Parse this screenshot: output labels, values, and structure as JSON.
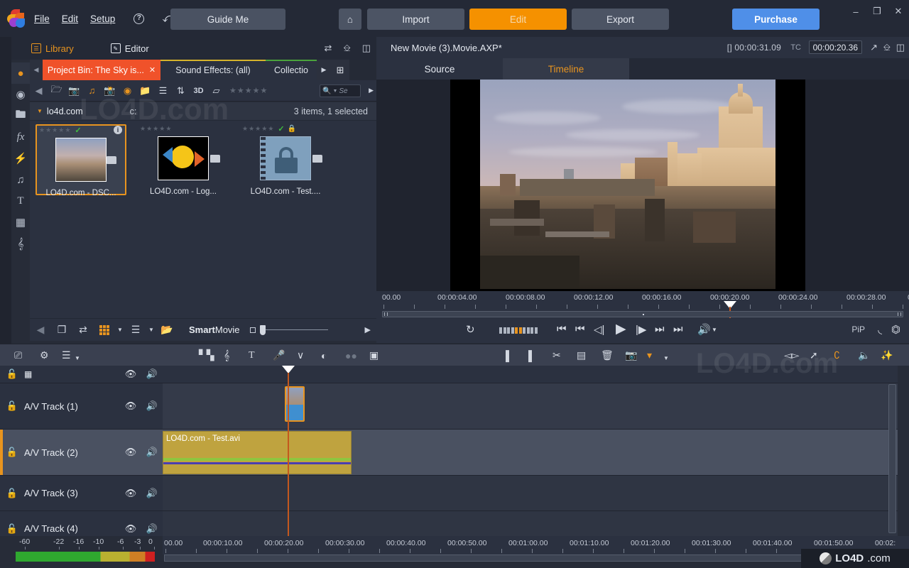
{
  "titlebar": {
    "menus": [
      "File",
      "Edit",
      "Setup"
    ],
    "help_icon": "help-icon",
    "undo_icon": "undo-arrow-icon",
    "redo_icon": "redo-arrow-icon",
    "guide_me": "Guide Me",
    "home_icon": "home-icon",
    "import": "Import",
    "edit": "Edit",
    "export": "Export",
    "purchase": "Purchase",
    "minimize": "–",
    "maximize": "❐",
    "close": "✕",
    "accent_orange": "#f59100",
    "accent_blue": "#4f8fe8"
  },
  "library": {
    "tab_library": "Library",
    "tab_editor": "Editor",
    "bin_tabs": [
      {
        "label": "Project Bin: The Sky is...",
        "close": "✕",
        "accent": "#f0522a",
        "active": true
      },
      {
        "label": "Sound Effects: (all)",
        "accent": "#d6b32b",
        "active": false
      },
      {
        "label": "Collectio",
        "accent": "#4aa33c",
        "active": false
      }
    ],
    "search_placeholder": "Se",
    "path_name": "lo4d.com",
    "path_drive": "c:",
    "item_count": "3 items, 1 selected",
    "items": [
      {
        "caption": "LO4D.com - DSC...",
        "selected": true,
        "checked": true,
        "locked": false,
        "info": true,
        "kind": "photo"
      },
      {
        "caption": "LO4D.com - Log...",
        "selected": false,
        "checked": false,
        "locked": false,
        "info": false,
        "kind": "logo"
      },
      {
        "caption": "LO4D.com - Test....",
        "selected": false,
        "checked": true,
        "locked": true,
        "info": false,
        "kind": "video"
      }
    ],
    "footer": {
      "smart_movie_bold": "Smart",
      "smart_movie_rest": "Movie"
    }
  },
  "preview": {
    "project_name": "New Movie (3).Movie.AXP*",
    "duration_label": "[]",
    "duration": "00:00:31.09",
    "tc_label": "TC",
    "tc_value": "00:00:20.36",
    "tab_source": "Source",
    "tab_timeline": "Timeline",
    "pip_label": "PiP",
    "ruler_ticks": [
      "00.00",
      "00:00:04.00",
      "00:00:08.00",
      "00:00:12.00",
      "00:00:16.00",
      "00:00:20.00",
      "00:00:24.00",
      "00:00:28.00",
      "0"
    ],
    "playhead_time": "00:00:20.00"
  },
  "timeline": {
    "tracks": [
      {
        "name": "",
        "selected": false,
        "master": true
      },
      {
        "name": "A/V Track (1)",
        "selected": false
      },
      {
        "name": "A/V Track (2)",
        "selected": true
      },
      {
        "name": "A/V Track (3)",
        "selected": false
      },
      {
        "name": "A/V Track (4)",
        "selected": false
      }
    ],
    "clips": [
      {
        "track": 2,
        "label": "LO4D.com - Test.avi",
        "type": "audio-video"
      },
      {
        "track": 1,
        "label": "",
        "type": "video-thumb"
      }
    ],
    "ruler_ticks": [
      "00.00",
      "00:00:10.00",
      "00:00:20.00",
      "00:00:30.00",
      "00:00:40.00",
      "00:00:50.00",
      "00:01:00.00",
      "00:01:10.00",
      "00:01:20.00",
      "00:01:30.00",
      "00:01:40.00",
      "00:01:50.00",
      "00:02:"
    ],
    "meter_labels": [
      "-60",
      "-22",
      "-16",
      "-10",
      "-6",
      "-3",
      "0"
    ]
  },
  "watermark": {
    "text": "LO4D",
    "suffix": ".com"
  }
}
